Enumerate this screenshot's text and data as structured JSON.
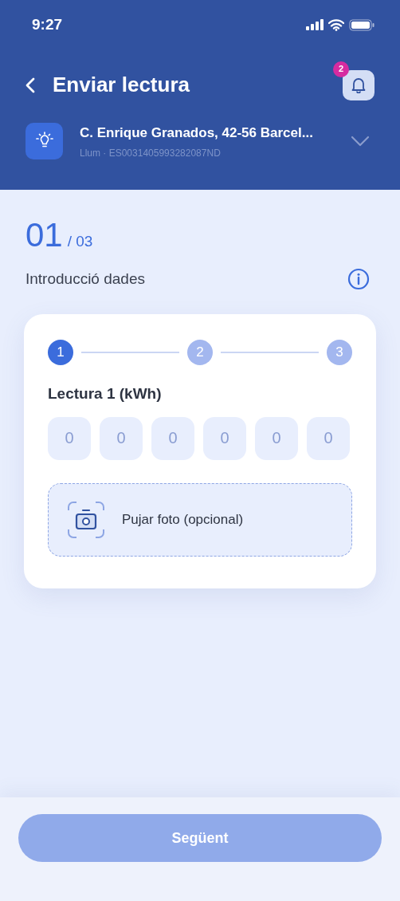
{
  "status_bar": {
    "time": "9:27"
  },
  "header": {
    "title": "Enviar lectura",
    "notifications": "2"
  },
  "supply": {
    "address": "C. Enrique Granados, 42-56 Barcel...",
    "detail": "Llum · ES0031405993282087ND"
  },
  "progress": {
    "current": "01",
    "total": "/ 03"
  },
  "section": {
    "title": "Introducció dades"
  },
  "steps": [
    {
      "label": "1",
      "selected": true
    },
    {
      "label": "2",
      "selected": false
    },
    {
      "label": "3",
      "selected": false
    }
  ],
  "reading": {
    "label": "Lectura 1 (kWh)",
    "digits": [
      {
        "placeholder": "0"
      },
      {
        "placeholder": "0"
      },
      {
        "placeholder": "0"
      },
      {
        "placeholder": "0"
      },
      {
        "placeholder": "0"
      },
      {
        "placeholder": "0"
      }
    ]
  },
  "upload": {
    "label": "Pujar foto (opcional)"
  },
  "next_button": {
    "label": "Següent",
    "disabled": true
  }
}
